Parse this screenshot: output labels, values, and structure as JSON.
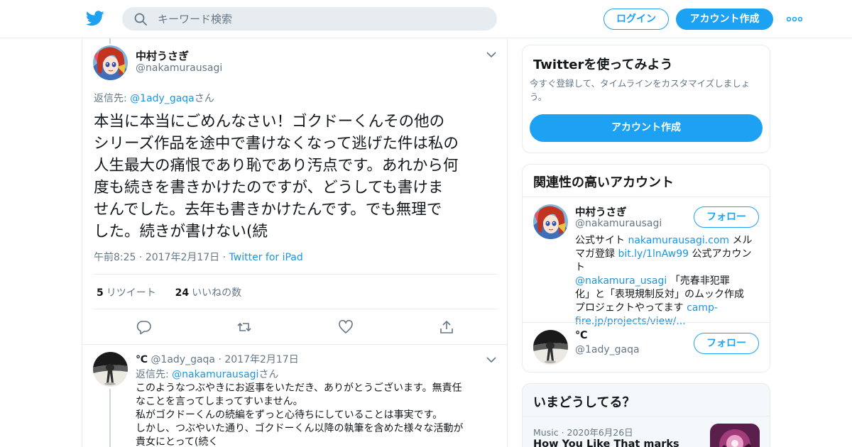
{
  "header": {
    "search_placeholder": "キーワード検索",
    "login_label": "ログイン",
    "signup_label": "アカウント作成"
  },
  "tweet": {
    "display_name": "中村うさぎ",
    "handle": "@nakamurausagi",
    "reply_prefix": "返信先: ",
    "reply_handle": "@1ady_gaqa",
    "reply_suffix": "さん",
    "text_lines": [
      "本当に本当にごめんなさい！ゴクドーくんその他の",
      "シリーズ作品を途中で書けなくなって逃げた件は私の",
      "人生最大の痛恨であり恥であり汚点です。あれから何",
      "度も続きを書きかけたのですが、どうしても書けま",
      "せんでした。去年も書きかけたんです。でも無理で",
      "した。続きが書けない(続"
    ],
    "time": "午前8:25",
    "date": "2017年2月17日",
    "source": "Twitter for iPad",
    "retweets_count": "5",
    "retweets_label": "リツイート",
    "likes_count": "24",
    "likes_label": "いいねの数"
  },
  "reply": {
    "display_name": "℃",
    "handle": "@1ady_gaqa",
    "date": "2017年2月17日",
    "reply_prefix": "返信先: ",
    "reply_handle": "@nakamurausagi",
    "reply_suffix": "さん",
    "text_lines": [
      "このようなつぶやきにお返事をいただき、ありがとうございます。無責任",
      "なことを言ってしまってすいません。",
      "私がゴクドーくんの続編をずっと心待ちにしていることは事実です。",
      "しかし、つぶやいた通り、ゴクドーくん以降の執筆を含めた様々な活動が",
      "貴女にとって(続く"
    ]
  },
  "sidebar": {
    "signup_card": {
      "title": "Twitterを使ってみよう",
      "desc_line1": "今すぐ登録して、タイムラインをカスタマイズしましょ",
      "desc_line2": "う。",
      "button": "アカウント作成"
    },
    "related_card": {
      "title": "関連性の高いアカウント",
      "accounts": [
        {
          "name": "中村うさぎ",
          "handle": "@nakamurausagi",
          "follow": "フォロー",
          "bio": {
            "l1a": "公式サイト ",
            "l1b": "nakamurausagi.com",
            "l1c": " メル",
            "l2a": "マガ登録 ",
            "l2b": "bit.ly/1lnAw99",
            "l2c": " 公式アカウント",
            "l3a": "@nakamura_usagi",
            "l3b": " 「売春非犯罪",
            "l4": "化」と「表現規制反対」のムック作成",
            "l5a": "プロジェクトやってます ",
            "l5b": "camp-",
            "l6": "fire.jp/projects/view/..."
          }
        },
        {
          "name": "℃",
          "handle": "@1ady_gaqa",
          "follow": "フォロー"
        }
      ]
    },
    "trends_card": {
      "title": "いまどうしてる？",
      "category": "Music",
      "date": "2020年6月26日",
      "headline": "How You Like That marks"
    }
  },
  "colors": {
    "accent": "#1da1f2",
    "link": "#1b95e0",
    "secondary_text": "#657786",
    "border": "#e6ecf0"
  },
  "icons": [
    "twitter-bird-icon",
    "search-icon",
    "more-dots-icon",
    "chevron-down-icon",
    "reply-icon",
    "retweet-icon",
    "like-icon",
    "share-icon"
  ]
}
